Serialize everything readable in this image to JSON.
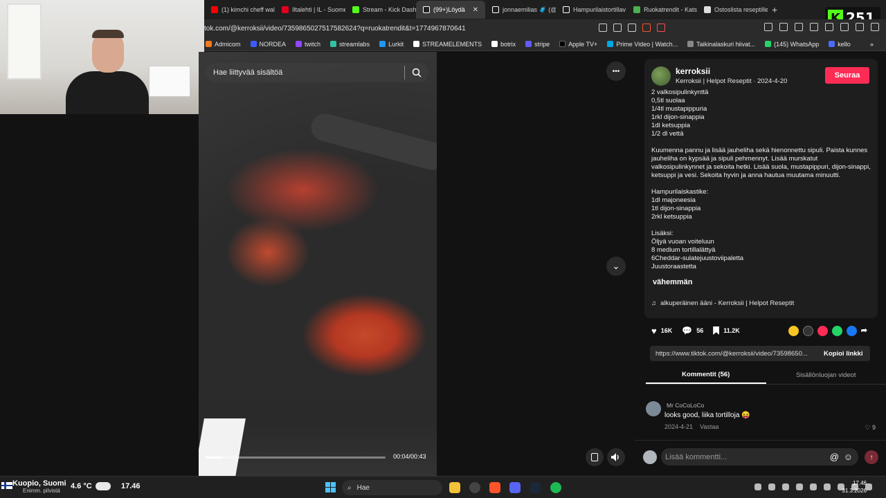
{
  "browser": {
    "tabs": [
      {
        "label": "(1) kimchi cheff wall",
        "color": "#ff0000",
        "active": false
      },
      {
        "label": "Iltalehti | IL - Suome",
        "color": "#e3001b",
        "active": false
      },
      {
        "label": "Stream - Kick Dashb",
        "color": "#53fc18",
        "active": false
      },
      {
        "label": "(99+)Löydä",
        "color": "#ffffff",
        "active": true
      },
      {
        "label": "jonnaemilias 🧳 (@",
        "color": "#ffffff",
        "active": false
      },
      {
        "label": "Hampurilaistortillav",
        "color": "#ffffff",
        "active": false
      },
      {
        "label": "Ruokatrendit - Kats",
        "color": "#4caf50",
        "active": false
      },
      {
        "label": "Ostoslista reseptille",
        "color": "#dddddd",
        "active": false
      }
    ],
    "new_tab": "+",
    "url": "tok.com/@kerroksii/video/7359865027517582624?q=ruokatrendit&t=1774967870641",
    "bookmarks": [
      {
        "label": "Admicom",
        "color": "#f47b20"
      },
      {
        "label": "NORDEA",
        "color": "#3d5afe"
      },
      {
        "label": "twitch",
        "color": "#9146ff"
      },
      {
        "label": "streamlabs",
        "color": "#31c3a2"
      },
      {
        "label": "Lurkit",
        "color": "#2196f3"
      },
      {
        "label": "STREAMELEMENTS",
        "color": "#ffffff"
      },
      {
        "label": "botrix",
        "color": "#ffffff"
      },
      {
        "label": "stripe",
        "color": "#635bff"
      },
      {
        "label": "Apple TV+",
        "color": "#000000"
      },
      {
        "label": "Prime Video | Watch...",
        "color": "#00a8e1"
      },
      {
        "label": "Taikinalaskuri hiivat...",
        "color": "#888888"
      },
      {
        "label": "(145) WhatsApp",
        "color": "#25d366"
      },
      {
        "label": "kello",
        "color": "#4a6cff"
      }
    ],
    "bookmarks_more": "»"
  },
  "kick_badge": {
    "count": "251",
    "logo": "K"
  },
  "video": {
    "search_placeholder": "Hae liittyvää sisältöä",
    "time": "00:04/00:43",
    "progress": 0.09,
    "more_icon": "•••",
    "next_icon": "⌄"
  },
  "post": {
    "username": "kerroksii",
    "subline": "Kerroksii | Helpot Reseptit · 2024-4-20",
    "follow": "Seuraa",
    "description": "2 valkosipulinkynttä\n0,5tl suolaa\n1/4tl mustapippuria\n1rkl dijon-sinappia\n1dl ketsuppia\n1/2 dl vettä\n\nKuumenna pannu ja lisää jauheliha sekä hienonnettu sipuli. Paista kunnes jauheliha on kypsää ja sipuli pehmennyt. Lisää murskatut valkosipulinkynnet ja sekoita hetki. Lisää suola, mustapippuri, dijon-sinappi, ketsuppi ja vesi. Sekoita hyvin ja anna hautua muutama minuutti.\n\nHampurilaiskastike:\n1dl majoneesia\n1tl dijon-sinappia\n2rkl ketsuppia\n\nLisäksi:\nÖljyä vuoan voiteluun\n8 medium tortillalättyä\n6Cheddar-sulatejuustoviipaletta\nJuustoraastetta",
    "less": "vähemmän",
    "sound": "alkuperäinen ääni - Kerroksii | Helpot Reseptit",
    "likes": "16K",
    "comments": "56",
    "saves": "11.2K",
    "link": "https://www.tiktok.com/@kerroksii/video/73598650...",
    "copy_link": "Kopioi linkki",
    "tab_comments": "Kommentit (56)",
    "tab_creator": "Sisällönluojan videot"
  },
  "comment": {
    "author": "Mr CoCoLoCo",
    "text": "looks good, liika tortilloja 😝",
    "date": "2024-4-21",
    "reply": "Vastaa",
    "likes": "9"
  },
  "comment_input": {
    "placeholder": "Lisää kommentti...",
    "at": "@",
    "emoji": "☺",
    "send": "↑"
  },
  "taskbar": {
    "location": "Kuopio, Suomi",
    "weather_sub": "Enimm. pilvistä",
    "temp": "4.6 °C",
    "temp2": "17.46",
    "search": "Hae",
    "time": "17.46",
    "date": "31.3.2026"
  }
}
